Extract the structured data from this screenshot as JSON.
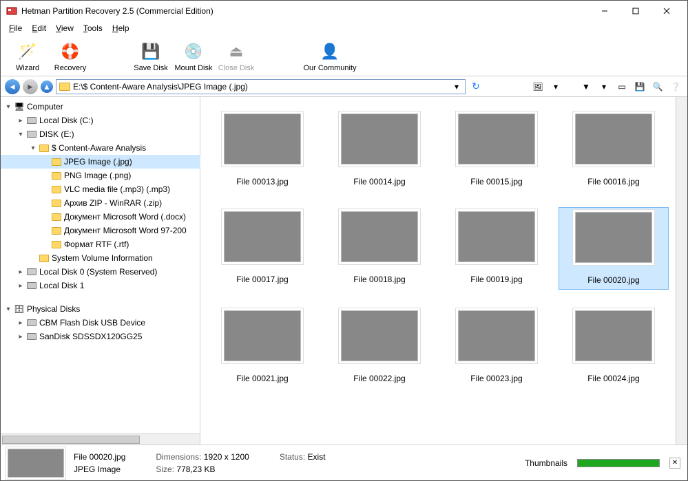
{
  "titlebar": {
    "title": "Hetman Partition Recovery 2.5 (Commercial Edition)"
  },
  "menubar": [
    {
      "letter": "F",
      "rest": "ile"
    },
    {
      "letter": "E",
      "rest": "dit"
    },
    {
      "letter": "V",
      "rest": "iew"
    },
    {
      "letter": "T",
      "rest": "ools"
    },
    {
      "letter": "H",
      "rest": "elp"
    }
  ],
  "toolbar": {
    "wizard": "Wizard",
    "recovery": "Recovery",
    "save_disk": "Save Disk",
    "mount_disk": "Mount Disk",
    "close_disk": "Close Disk",
    "community": "Our Community"
  },
  "address": "E:\\$ Content-Aware Analysis\\JPEG Image (.jpg)",
  "tree": {
    "computer": "Computer",
    "local_c": "Local Disk (C:)",
    "disk_e": "DISK (E:)",
    "content_aware": "$ Content-Aware Analysis",
    "jpeg": "JPEG Image (.jpg)",
    "png": "PNG Image (.png)",
    "vlc": "VLC media file (.mp3) (.mp3)",
    "zip": "Архив ZIP - WinRAR (.zip)",
    "docx": "Документ Microsoft Word (.docx)",
    "doc97": "Документ Microsoft Word 97-200",
    "rtf": "Формат RTF (.rtf)",
    "svi": "System Volume Information",
    "local0": "Local Disk 0 (System Reserved)",
    "local1": "Local Disk 1",
    "physical": "Physical Disks",
    "cbm": "CBM Flash Disk USB Device",
    "sandisk": "SanDisk SDSSDX120GG25"
  },
  "files": [
    {
      "name": "File 00013.jpg",
      "cls": "bg1"
    },
    {
      "name": "File 00014.jpg",
      "cls": "bg2"
    },
    {
      "name": "File 00015.jpg",
      "cls": "bg3"
    },
    {
      "name": "File 00016.jpg",
      "cls": "bg4"
    },
    {
      "name": "File 00017.jpg",
      "cls": "bg5"
    },
    {
      "name": "File 00018.jpg",
      "cls": "bg6"
    },
    {
      "name": "File 00019.jpg",
      "cls": "bg7"
    },
    {
      "name": "File 00020.jpg",
      "cls": "bg8",
      "selected": true
    },
    {
      "name": "File 00021.jpg",
      "cls": "bg9"
    },
    {
      "name": "File 00022.jpg",
      "cls": "bg10"
    },
    {
      "name": "File 00023.jpg",
      "cls": "bg11"
    },
    {
      "name": "File 00024.jpg",
      "cls": "bg12"
    }
  ],
  "status": {
    "filename": "File 00020.jpg",
    "filetype": "JPEG Image",
    "dim_label": "Dimensions:",
    "dim_value": "1920 x 1200",
    "size_label": "Size:",
    "size_value": "778,23 KB",
    "status_label": "Status:",
    "status_value": "Exist",
    "view_label": "Thumbnails"
  }
}
